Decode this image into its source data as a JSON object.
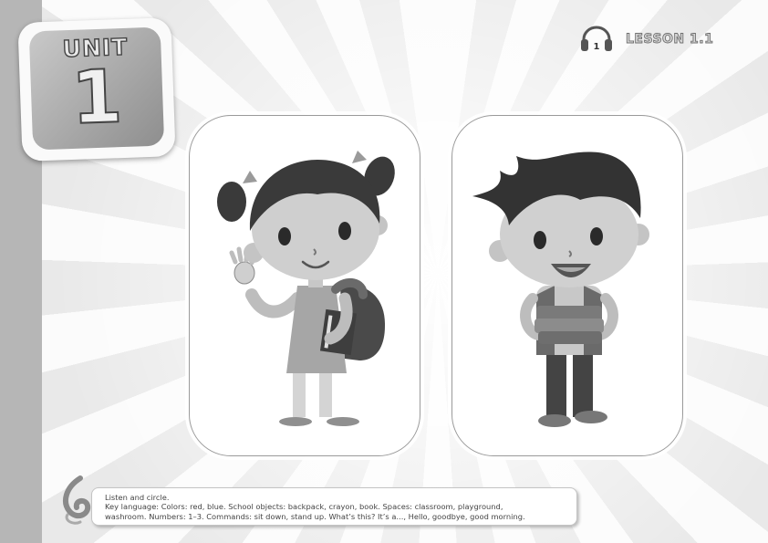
{
  "unit": {
    "label": "UNIT",
    "number": "1"
  },
  "lesson": {
    "label": "LESSON 1.1",
    "audio_track": "1",
    "icon": "headphones-icon"
  },
  "cards": [
    {
      "name": "girl-flashcard",
      "illustration": "girl-with-backpack"
    },
    {
      "name": "boy-flashcard",
      "illustration": "boy-holding-books"
    }
  ],
  "instructions": {
    "title": "Listen and circle.",
    "key_language_line1": "Key language: Colors: red, blue. School objects: backpack, crayon, book. Spaces: classroom, playground,",
    "key_language_line2": "washroom. Numbers: 1–3. Commands: sit down, stand up. What’s this? It’s a..., Hello, goodbye, good morning."
  },
  "colors": {
    "sidebar": "#b6b6b6",
    "badge": "#9f9f9f",
    "hair": "#3a3a3a",
    "skin": "#cfcfcf"
  }
}
